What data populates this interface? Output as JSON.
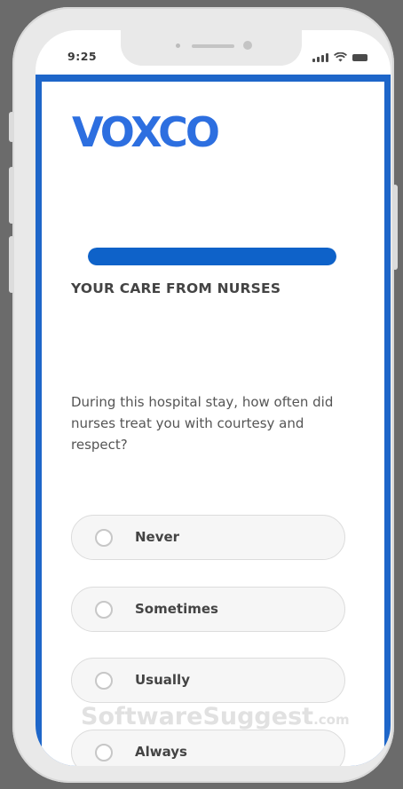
{
  "status_bar": {
    "time": "9:25"
  },
  "brand": {
    "logo_text": "VOXCO",
    "color": "#2d6fe0"
  },
  "survey": {
    "progress": 1.0,
    "progress_color": "#0e62c9",
    "section_title": "YOUR CARE FROM NURSES",
    "question": "During this hospital stay, how often did nurses treat you with courtesy and respect?",
    "options": [
      {
        "label": "Never",
        "selected": false
      },
      {
        "label": "Sometimes",
        "selected": false
      },
      {
        "label": "Usually",
        "selected": false
      },
      {
        "label": "Always",
        "selected": false
      }
    ]
  },
  "watermark": {
    "text": "SoftwareSuggest",
    "suffix": ".com"
  },
  "icons": [
    "signal-icon",
    "wifi-icon",
    "battery-icon",
    "radio-icon"
  ]
}
